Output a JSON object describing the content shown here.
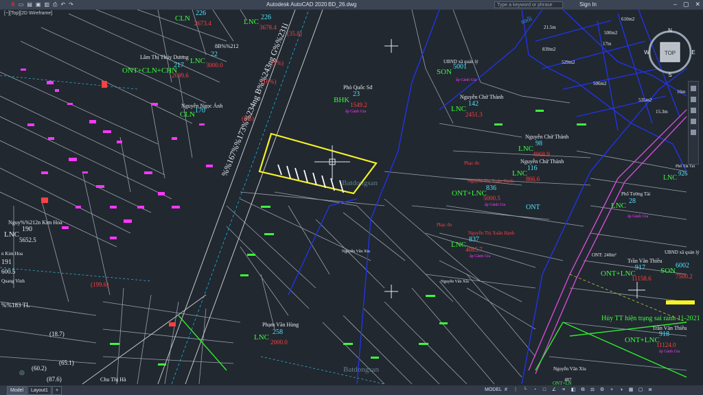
{
  "window": {
    "app_title": "Autodesk AutoCAD 2020",
    "file_name": "BD_26.dwg",
    "search_placeholder": "Type a keyword or phrase",
    "sign_in": "Sign In",
    "view_label": "[−][Top][2D Wireframe]"
  },
  "viewcube": {
    "top": "TOP",
    "n": "N",
    "s": "S",
    "e": "E",
    "w": "W"
  },
  "status": {
    "tabs": [
      "Model",
      "Layout1",
      "+"
    ],
    "model": "MODEL"
  },
  "labels": {
    "cln226": "CLN",
    "n226": "226",
    "a226": "2673.4",
    "lnc226": "LNC",
    "l226": "226",
    "a226b": "3678.4",
    "n358": "(35.8)",
    "road": "%%167%%173%%234ng B%%243ng G%%231i",
    "n5": "(5%)",
    "n8": "(8%)",
    "n16": "(16%)",
    "n199": "(199.6)",
    "ont217": "ONT+CLN+CHN",
    "n217": "217",
    "a217": "2099.6",
    "owner217": "Lâm Thị Thúy Dương",
    "lnc22": "LNC",
    "n22": "22",
    "a22": "3000.0",
    "code212": "8B%%212",
    "owner170": "Nguyễn Ngọc Ánh",
    "cln170": "CLN",
    "n170": "170",
    "owner_qs": "Phò Quốc Sđ",
    "bhk": "BHK",
    "n23": "23",
    "a23": "1549.2",
    "loc23": "ấp Gành Gia",
    "ubnd": "UBND xã quản lý",
    "son": "SON",
    "n5001": "5001",
    "loc5001": "ấp Gành Gia",
    "owner142": "Nguyễn Chử Thành",
    "lnc142": "LNC",
    "n142": "142",
    "a142": "2451.3",
    "owner98": "Nguyễn Chử Thành",
    "lnc98": "LNC",
    "n98": "98",
    "a98": "4968.9",
    "owner116": "Nguyễn Chử Thành",
    "lnc116": "LNC",
    "n116": "116",
    "a116": "866.6",
    "phuc": "Phạc đo",
    "owner836": "Nguyễn Thị Xuân Hạnh",
    "ont836": "ONT+LNC",
    "n836": "836",
    "a836": "5000.5",
    "loc836": "ấp Gành Gia",
    "ont": "ONT",
    "owner837": "Nguyễn Thị Xuân Hạnh",
    "lnc837": "LNC",
    "n837": "837",
    "a837": "4085.7",
    "loc837": "ấp Gành Gia",
    "phuc2": "Phạc đo",
    "owner190": "Nguy%%212n Kim Hoa",
    "lnc190": "LNC",
    "n190": "190",
    "a190": "5652.5",
    "n191": "191",
    "a191": "600.5",
    "kim": "n Kim Hoa",
    "vinh": "Quang Vinh",
    "lnc183": "%%183 TL",
    "n187": "(18.7)",
    "n602": "(60.2)",
    "n651": "(65.1)",
    "n876": "(87.6)",
    "owner258": "Phạm Văn Hùng",
    "lnc258": "LNC",
    "n258": "258",
    "a258": "2000.0",
    "owner_xiu": "Nguyễn Văn Xiu",
    "owner_xiu2": "Nguyễn Văn Xíu",
    "cha": "Chu Thị Hà",
    "ont240": "ONT: 240m²",
    "owner28": "Phố Tường Tài",
    "lnc28": "LNC",
    "n28": "28",
    "loc28": "ấp Gành Gia",
    "owner6002": "UBND xã quản lý",
    "son6002": "SON",
    "n6002": "6002",
    "a6002": "7500.2",
    "owner917": "Trần Văn Thiều",
    "ont917": "ONT+LNC",
    "n917": "917",
    "a917": "11158.6",
    "huy": "Hủy TT hiện trạng sai ranh 11-2021",
    "owner918": "Trần Văn Thiều",
    "ont918": "ONT+LNC",
    "n918": "918",
    "a918": "11124.0",
    "loc918": "ấp Gành Gia",
    "suoi": "suối",
    "a610": "610m2",
    "a500": "500m2",
    "a839": "839m2",
    "a529": "529m2",
    "a506": "506m2",
    "a535": "535m2",
    "d125": "21.5m",
    "d17": "17m",
    "d15": "15.3m",
    "d16": "16m",
    "lnc926": "LNC",
    "n926": "926",
    "owner926": "Phố Tài Tài",
    "n487": "487",
    "ont_ln": "ONT+LN",
    "xiu_bottom": "Nguyễn Văn Xíu",
    "watermark": "Batdongsan",
    "watermark2": "Batdongsan"
  },
  "colors": {
    "bg": "#212830",
    "yellow": "#f5f225",
    "magenta": "#ff37ff",
    "cyan": "#4fe7ff",
    "green": "#3dfb3d",
    "red": "#ff4040",
    "blue": "#1b2ddc",
    "white": "#e8ecef"
  }
}
